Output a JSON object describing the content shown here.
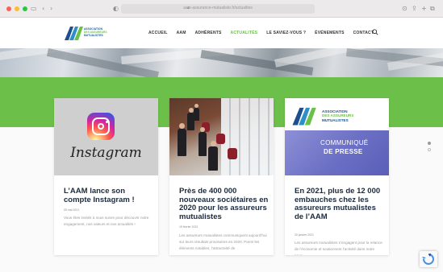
{
  "browser": {
    "url": "aam-assurance-mutualiste.fr/actualites",
    "colors": {
      "close": "#ff5f57",
      "min": "#febc2e",
      "max": "#28c840"
    }
  },
  "logo": {
    "line1": "ASSOCIATION",
    "line2": "DES ASSUREURS",
    "line3": "MUTUALISTES"
  },
  "nav": {
    "items": [
      "ACCUEIL",
      "AAM",
      "ADHÉRENTS",
      "ACTUALITÉS",
      "LE SAVIEZ-VOUS ?",
      "ÉVÉNEMENTS",
      "CONTACT"
    ],
    "active_index": 3,
    "accent": "#6cc04a"
  },
  "cards": [
    {
      "image_word": "Instagram",
      "title": "L’AAM lance son compte Instagram !",
      "date": "05 mai 2021",
      "excerpt": "Vous êtes invités à nous suivre pour découvrir notre engagement, nos valeurs et nos actualités !"
    },
    {
      "title": "Près de 400 000 nouveaux sociétaires en 2020 pour les assureurs mutualistes",
      "date": "15 février 2021",
      "excerpt": "Les assureurs mutualistes communiquent aujourd’hui sur leurs résultats provisoires en 2020. Parmi les éléments notables, l’attractivité de"
    },
    {
      "image_logo_line1": "ASSOCIATION",
      "image_logo_line2": "DES ASSUREURS",
      "image_logo_line3": "MUTUALISTES",
      "image_label1": "COMMUNIQUÉ",
      "image_label2": "DE PRESSE",
      "title": "En 2021, plus de 12 000 embauches chez les assureurs mutualistes de l’AAM",
      "date": "20 janvier 2021",
      "excerpt": "Les assureurs mutualistes s’engagent pour la relance de l’économie et soutiennent l’activité dans notre pays,"
    }
  ]
}
